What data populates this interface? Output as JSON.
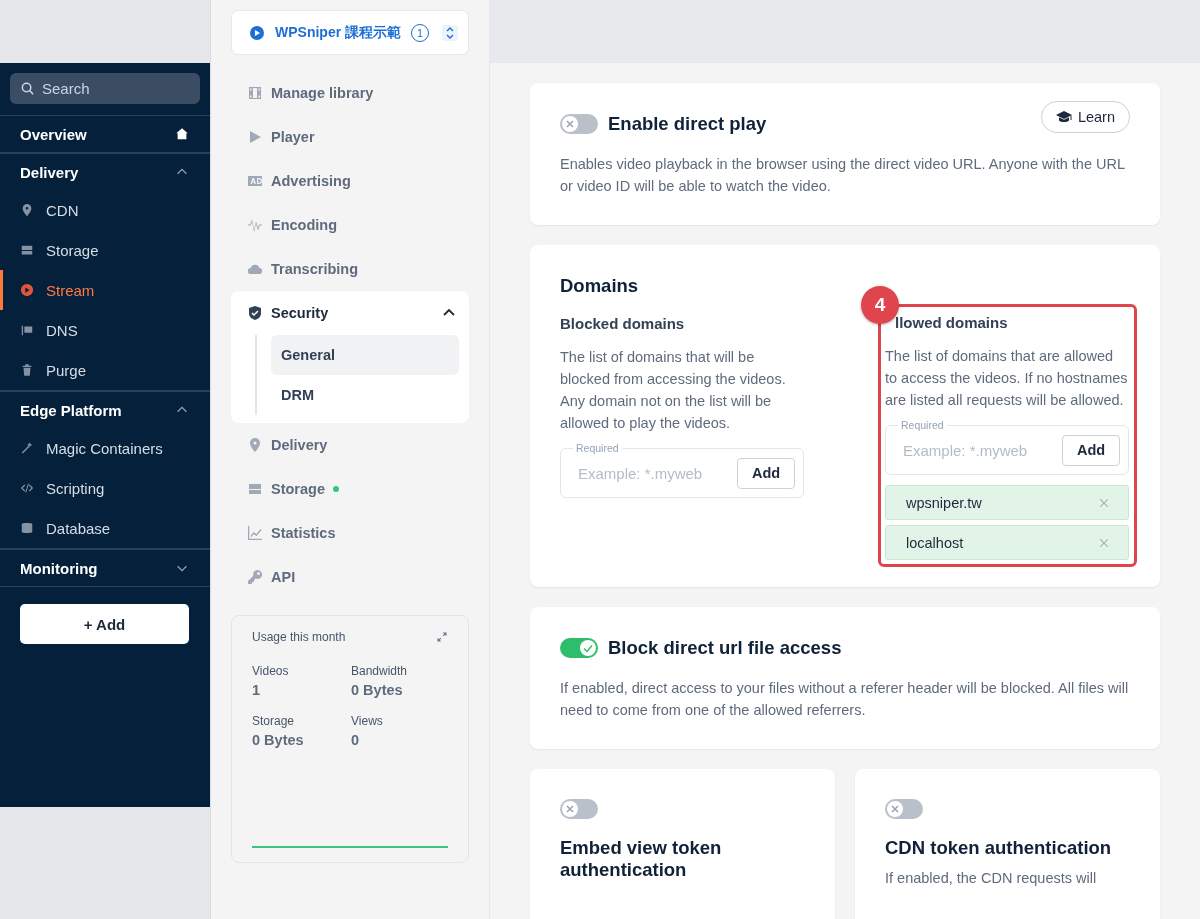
{
  "sidebar": {
    "search": {
      "placeholder": "Search"
    },
    "sections": [
      {
        "title": "Overview",
        "kind": "link"
      },
      {
        "title": "Delivery",
        "kind": "group",
        "expanded": true,
        "items": [
          {
            "label": "CDN",
            "selected": false
          },
          {
            "label": "Storage",
            "selected": false
          },
          {
            "label": "Stream",
            "selected": true
          },
          {
            "label": "DNS",
            "selected": false
          },
          {
            "label": "Purge",
            "selected": false
          }
        ]
      },
      {
        "title": "Edge Platform",
        "kind": "group",
        "expanded": true,
        "items": [
          {
            "label": "Magic Containers",
            "selected": false
          },
          {
            "label": "Scripting",
            "selected": false
          },
          {
            "label": "Database",
            "selected": false
          }
        ]
      },
      {
        "title": "Monitoring",
        "kind": "group",
        "expanded": false
      }
    ],
    "add_button": "+ Add"
  },
  "library_nav": {
    "selector": {
      "name": "WPSniper 課程示範",
      "count": "1"
    },
    "items": [
      {
        "label": "Manage library",
        "selected": false
      },
      {
        "label": "Player",
        "selected": false
      },
      {
        "label": "Advertising",
        "selected": false
      },
      {
        "label": "Encoding",
        "selected": false
      },
      {
        "label": "Transcribing",
        "selected": false
      },
      {
        "label": "Security",
        "expanded": true,
        "children": [
          {
            "label": "General",
            "selected": true
          },
          {
            "label": "DRM",
            "selected": false
          }
        ]
      },
      {
        "label": "Delivery",
        "selected": false
      },
      {
        "label": "Storage",
        "selected": false,
        "color": "#34c77b"
      },
      {
        "label": "Statistics",
        "selected": false
      },
      {
        "label": "API",
        "selected": false
      }
    ],
    "usage": {
      "title": "Usage this month",
      "stats": [
        {
          "label": "Videos",
          "value": "1"
        },
        {
          "label": "Bandwidth",
          "value": "0 Bytes"
        },
        {
          "label": "Storage",
          "value": "0 Bytes"
        },
        {
          "label": "Views",
          "value": "0"
        }
      ]
    }
  },
  "cards": [
    {
      "kind": "toggle",
      "on": false,
      "title": "Enable direct play",
      "learn_button": "Learn",
      "description": "Enables video playback in the browser using the direct video URL. Anyone with the URL or video ID will be able to watch the video."
    },
    {
      "kind": "domains",
      "title": "Domains",
      "lists": [
        {
          "label": "Blocked domains",
          "description": "The list of domains that will be blocked from accessing the videos. Any domain not on the list will be allowed to play the videos.",
          "field_label": "Required",
          "placeholder": "Example: *.myweb",
          "button": "Add"
        },
        {
          "label": "llowed domains",
          "description": "The list of domains that are allowed to access the videos. If no hostnames are listed all requests will be allowed.",
          "field_label": "Required",
          "placeholder": "Example: *.myweb",
          "button": "Add",
          "tags": [
            "wpsniper.tw",
            "localhost"
          ],
          "callout": "4"
        }
      ]
    },
    {
      "kind": "toggle",
      "on": true,
      "title": "Block direct url file access",
      "description": "If enabled, direct access to your files without a referer header will be blocked. All files will need to come from one of the allowed referrers."
    },
    {
      "kind": "pair",
      "cards": [
        {
          "on": false,
          "title": "Embed view token authentication"
        },
        {
          "on": false,
          "title": "CDN token authentication",
          "description": "If enabled, the CDN requests will"
        }
      ]
    }
  ]
}
